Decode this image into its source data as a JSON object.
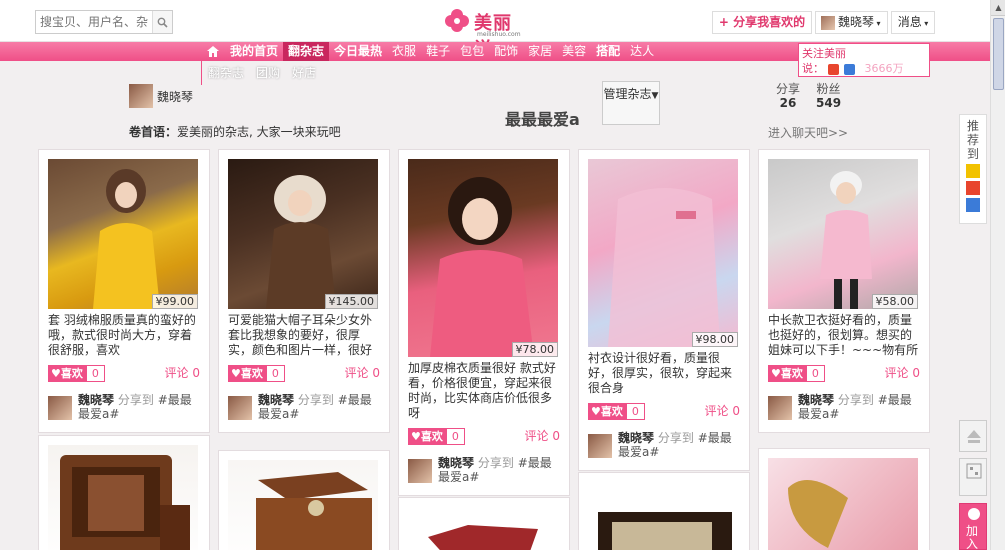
{
  "search": {
    "placeholder": "搜宝贝、用户名、杂"
  },
  "logo": {
    "name": "美丽说",
    "domain": "meilishuo.com"
  },
  "header": {
    "share": "+ 分享我喜欢的",
    "user": "魏晓琴",
    "messages": "消息"
  },
  "nav": [
    "我的首页",
    "翻杂志",
    "今日最热",
    "衣服",
    "鞋子",
    "包包",
    "配饰",
    "家居",
    "美容",
    "搭配",
    "达人"
  ],
  "subnav": [
    "翻杂志",
    "团购",
    "好店"
  ],
  "follow": {
    "line1": "关注美丽",
    "line2": "说：",
    "count": "3666万"
  },
  "magazine": {
    "owner": "魏晓琴",
    "title": "最最最爱a",
    "manage": "管理杂志",
    "share_label": "分享",
    "share_count": "26",
    "fans_label": "粉丝",
    "fans_count": "549",
    "motto_label": "卷首语：",
    "motto": "爱美丽的杂志, 大家一块来玩吧",
    "chat": "进入聊天吧>>"
  },
  "cards": [
    {
      "price": "¥99.00",
      "desc": "套 羽绒棉服质量真的蛮好的哦，款式很时尚大方，穿着很舒服，喜欢",
      "like": "喜欢",
      "like_count": "0",
      "comment": "评论 0",
      "user": "魏晓琴",
      "share_to": "分享到",
      "mag": "#最最最爱a#"
    },
    {
      "price": "¥145.00",
      "desc": "可爱能猫大帽子耳朵少女外套比我想象的要好，很厚实，颜色和图片一样，很好看。料子很好，也很合身",
      "like": "喜欢",
      "like_count": "0",
      "comment": "评论 0",
      "user": "魏晓琴",
      "share_to": "分享到",
      "mag": "#最最最爱a#"
    },
    {
      "price": "¥78.00",
      "desc": "加厚皮棉衣质量很好 款式好看，价格很便宜，穿起来很时尚，比实体商店价低很多呀",
      "like": "喜欢",
      "like_count": "0",
      "comment": "评论 0",
      "user": "魏晓琴",
      "share_to": "分享到",
      "mag": "#最最最爱a#"
    },
    {
      "price": "¥98.00",
      "desc": "衬衣设计很好看，质量很好，很厚实，很软，穿起来很合身",
      "like": "喜欢",
      "like_count": "0",
      "comment": "评论 0",
      "user": "魏晓琴",
      "share_to": "分享到",
      "mag": "#最最最爱a#"
    },
    {
      "price": "¥58.00",
      "desc": "中长款卫衣挺好看的，质量也挺好的，很划算。想买的姐妹可以下手！~~~物有所值",
      "like": "喜欢",
      "like_count": "0",
      "comment": "评论 0",
      "user": "魏晓琴",
      "share_to": "分享到",
      "mag": "#最最最爱a#"
    }
  ],
  "side": {
    "recommend": "推荐到",
    "join": "加入"
  },
  "colors": {
    "brand_pink": "#ef4f87",
    "nav_active": "#c9275e"
  }
}
